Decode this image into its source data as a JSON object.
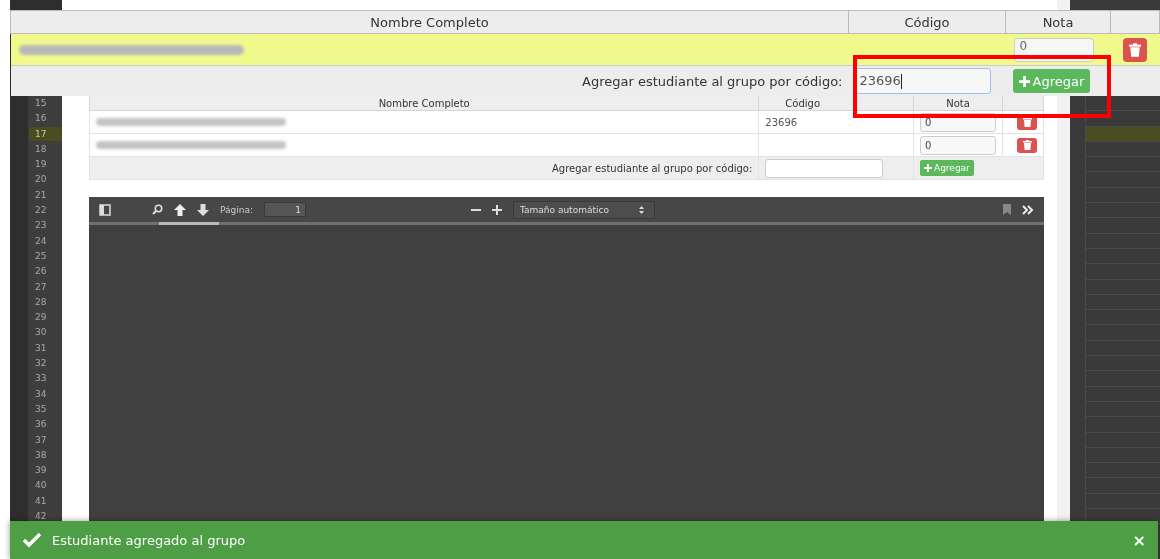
{
  "group_table": {
    "columns": [
      "Nombre Completo",
      "Código",
      "Nota"
    ],
    "rows": [
      {
        "code": "",
        "grade": "0",
        "selected": true
      }
    ],
    "add_label": "Agregar estudiante al grupo por código:",
    "add_value": "23696",
    "add_button": "Agregar"
  },
  "background": {
    "row_numbers": [
      {
        "label": "15",
        "selected": false
      },
      {
        "label": "16",
        "selected": false
      },
      {
        "label": "17",
        "selected": true
      },
      {
        "label": "18",
        "selected": false
      },
      {
        "label": "19",
        "selected": false
      },
      {
        "label": "20",
        "selected": false
      },
      {
        "label": "21",
        "selected": false
      },
      {
        "label": "22",
        "selected": false
      },
      {
        "label": "23",
        "selected": false
      },
      {
        "label": "24",
        "selected": false
      },
      {
        "label": "25",
        "selected": false
      },
      {
        "label": "26",
        "selected": false
      },
      {
        "label": "27",
        "selected": false
      },
      {
        "label": "28",
        "selected": false
      },
      {
        "label": "29",
        "selected": false
      },
      {
        "label": "30",
        "selected": false
      },
      {
        "label": "31",
        "selected": false
      },
      {
        "label": "32",
        "selected": false
      },
      {
        "label": "33",
        "selected": false
      },
      {
        "label": "34",
        "selected": false
      },
      {
        "label": "35",
        "selected": false
      },
      {
        "label": "36",
        "selected": false
      },
      {
        "label": "37",
        "selected": false
      },
      {
        "label": "38",
        "selected": false
      },
      {
        "label": "39",
        "selected": false
      },
      {
        "label": "40",
        "selected": false
      },
      {
        "label": "41",
        "selected": false
      },
      {
        "label": "42",
        "selected": false
      }
    ],
    "inner_table": {
      "columns": [
        "Nombre Completo",
        "Código",
        "Nota"
      ],
      "rows": [
        {
          "code": "23696",
          "grade": "0"
        },
        {
          "code": "",
          "grade": "0"
        }
      ],
      "add_label": "Agregar estudiante al grupo por código:",
      "add_button": "Agregar"
    },
    "pdf_toolbar": {
      "page_label": "Página:",
      "page_value": "1",
      "zoom": "Tamaño automático"
    }
  },
  "toast": {
    "message": "Estudiante agregado al grupo",
    "close": "×"
  }
}
